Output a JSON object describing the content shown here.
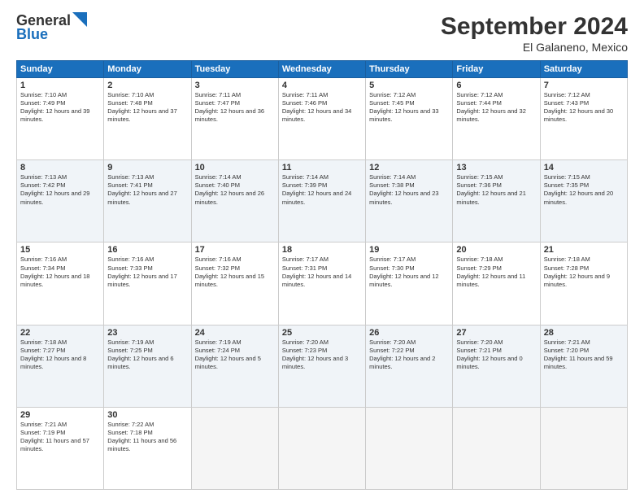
{
  "logo": {
    "line1": "General",
    "line2": "Blue"
  },
  "title": "September 2024",
  "subtitle": "El Galaneno, Mexico",
  "headers": [
    "Sunday",
    "Monday",
    "Tuesday",
    "Wednesday",
    "Thursday",
    "Friday",
    "Saturday"
  ],
  "rows": [
    [
      {
        "day": "1",
        "info": "Sunrise: 7:10 AM\nSunset: 7:49 PM\nDaylight: 12 hours and 39 minutes."
      },
      {
        "day": "2",
        "info": "Sunrise: 7:10 AM\nSunset: 7:48 PM\nDaylight: 12 hours and 37 minutes."
      },
      {
        "day": "3",
        "info": "Sunrise: 7:11 AM\nSunset: 7:47 PM\nDaylight: 12 hours and 36 minutes."
      },
      {
        "day": "4",
        "info": "Sunrise: 7:11 AM\nSunset: 7:46 PM\nDaylight: 12 hours and 34 minutes."
      },
      {
        "day": "5",
        "info": "Sunrise: 7:12 AM\nSunset: 7:45 PM\nDaylight: 12 hours and 33 minutes."
      },
      {
        "day": "6",
        "info": "Sunrise: 7:12 AM\nSunset: 7:44 PM\nDaylight: 12 hours and 32 minutes."
      },
      {
        "day": "7",
        "info": "Sunrise: 7:12 AM\nSunset: 7:43 PM\nDaylight: 12 hours and 30 minutes."
      }
    ],
    [
      {
        "day": "8",
        "info": "Sunrise: 7:13 AM\nSunset: 7:42 PM\nDaylight: 12 hours and 29 minutes."
      },
      {
        "day": "9",
        "info": "Sunrise: 7:13 AM\nSunset: 7:41 PM\nDaylight: 12 hours and 27 minutes."
      },
      {
        "day": "10",
        "info": "Sunrise: 7:14 AM\nSunset: 7:40 PM\nDaylight: 12 hours and 26 minutes."
      },
      {
        "day": "11",
        "info": "Sunrise: 7:14 AM\nSunset: 7:39 PM\nDaylight: 12 hours and 24 minutes."
      },
      {
        "day": "12",
        "info": "Sunrise: 7:14 AM\nSunset: 7:38 PM\nDaylight: 12 hours and 23 minutes."
      },
      {
        "day": "13",
        "info": "Sunrise: 7:15 AM\nSunset: 7:36 PM\nDaylight: 12 hours and 21 minutes."
      },
      {
        "day": "14",
        "info": "Sunrise: 7:15 AM\nSunset: 7:35 PM\nDaylight: 12 hours and 20 minutes."
      }
    ],
    [
      {
        "day": "15",
        "info": "Sunrise: 7:16 AM\nSunset: 7:34 PM\nDaylight: 12 hours and 18 minutes."
      },
      {
        "day": "16",
        "info": "Sunrise: 7:16 AM\nSunset: 7:33 PM\nDaylight: 12 hours and 17 minutes."
      },
      {
        "day": "17",
        "info": "Sunrise: 7:16 AM\nSunset: 7:32 PM\nDaylight: 12 hours and 15 minutes."
      },
      {
        "day": "18",
        "info": "Sunrise: 7:17 AM\nSunset: 7:31 PM\nDaylight: 12 hours and 14 minutes."
      },
      {
        "day": "19",
        "info": "Sunrise: 7:17 AM\nSunset: 7:30 PM\nDaylight: 12 hours and 12 minutes."
      },
      {
        "day": "20",
        "info": "Sunrise: 7:18 AM\nSunset: 7:29 PM\nDaylight: 12 hours and 11 minutes."
      },
      {
        "day": "21",
        "info": "Sunrise: 7:18 AM\nSunset: 7:28 PM\nDaylight: 12 hours and 9 minutes."
      }
    ],
    [
      {
        "day": "22",
        "info": "Sunrise: 7:18 AM\nSunset: 7:27 PM\nDaylight: 12 hours and 8 minutes."
      },
      {
        "day": "23",
        "info": "Sunrise: 7:19 AM\nSunset: 7:25 PM\nDaylight: 12 hours and 6 minutes."
      },
      {
        "day": "24",
        "info": "Sunrise: 7:19 AM\nSunset: 7:24 PM\nDaylight: 12 hours and 5 minutes."
      },
      {
        "day": "25",
        "info": "Sunrise: 7:20 AM\nSunset: 7:23 PM\nDaylight: 12 hours and 3 minutes."
      },
      {
        "day": "26",
        "info": "Sunrise: 7:20 AM\nSunset: 7:22 PM\nDaylight: 12 hours and 2 minutes."
      },
      {
        "day": "27",
        "info": "Sunrise: 7:20 AM\nSunset: 7:21 PM\nDaylight: 12 hours and 0 minutes."
      },
      {
        "day": "28",
        "info": "Sunrise: 7:21 AM\nSunset: 7:20 PM\nDaylight: 11 hours and 59 minutes."
      }
    ],
    [
      {
        "day": "29",
        "info": "Sunrise: 7:21 AM\nSunset: 7:19 PM\nDaylight: 11 hours and 57 minutes."
      },
      {
        "day": "30",
        "info": "Sunrise: 7:22 AM\nSunset: 7:18 PM\nDaylight: 11 hours and 56 minutes."
      },
      {
        "day": "",
        "info": ""
      },
      {
        "day": "",
        "info": ""
      },
      {
        "day": "",
        "info": ""
      },
      {
        "day": "",
        "info": ""
      },
      {
        "day": "",
        "info": ""
      }
    ]
  ]
}
